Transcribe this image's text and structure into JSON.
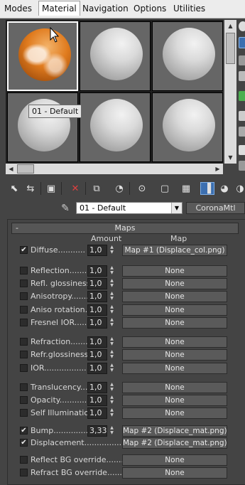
{
  "menu": [
    "Modes",
    "Material",
    "Navigation",
    "Options",
    "Utilities"
  ],
  "tooltip": "01 - Default",
  "material_name": "01 - Default",
  "material_type": "CoronaMtl",
  "rollout": {
    "toggle": "-",
    "title": "Maps"
  },
  "columns": {
    "amount": "Amount",
    "map": "Map"
  },
  "maps": [
    {
      "label": "Diffuse...........",
      "checked": true,
      "amount": "1,0",
      "map": "Map #1 (Displace_col.png)"
    },
    {
      "label": "Reflection.........",
      "checked": false,
      "amount": "1,0",
      "map": "None"
    },
    {
      "label": "Refl. glossiness..",
      "checked": false,
      "amount": "1,0",
      "map": "None"
    },
    {
      "label": "Anisotropy.......",
      "checked": false,
      "amount": "1,0",
      "map": "None"
    },
    {
      "label": "Aniso rotation....",
      "checked": false,
      "amount": "1,0",
      "map": "None"
    },
    {
      "label": "Fresnel IOR.......",
      "checked": false,
      "amount": "1,0",
      "map": "None"
    },
    {
      "label": "Refraction........",
      "checked": false,
      "amount": "1,0",
      "map": "None"
    },
    {
      "label": "Refr.glossiness.",
      "checked": false,
      "amount": "1,0",
      "map": "None"
    },
    {
      "label": "IOR.................",
      "checked": false,
      "amount": "1,0",
      "map": "None"
    },
    {
      "label": "Translucency......",
      "checked": false,
      "amount": "1,0",
      "map": "None"
    },
    {
      "label": "Opacity.............",
      "checked": false,
      "amount": "1,0",
      "map": "None"
    },
    {
      "label": "Self Illumination.",
      "checked": false,
      "amount": "1,0",
      "map": "None"
    },
    {
      "label": "Bump...............",
      "checked": true,
      "amount": "3,33",
      "map": "Map #2 (Displace_mat.png)"
    },
    {
      "label": "Displacement.....................",
      "checked": true,
      "amount": "",
      "map": "Map #2 (Displace_mat.png)"
    },
    {
      "label": "Reflect BG override..................",
      "checked": false,
      "amount": "",
      "map": "None"
    },
    {
      "label": "Refract BG override..................",
      "checked": false,
      "amount": "",
      "map": "None"
    }
  ]
}
